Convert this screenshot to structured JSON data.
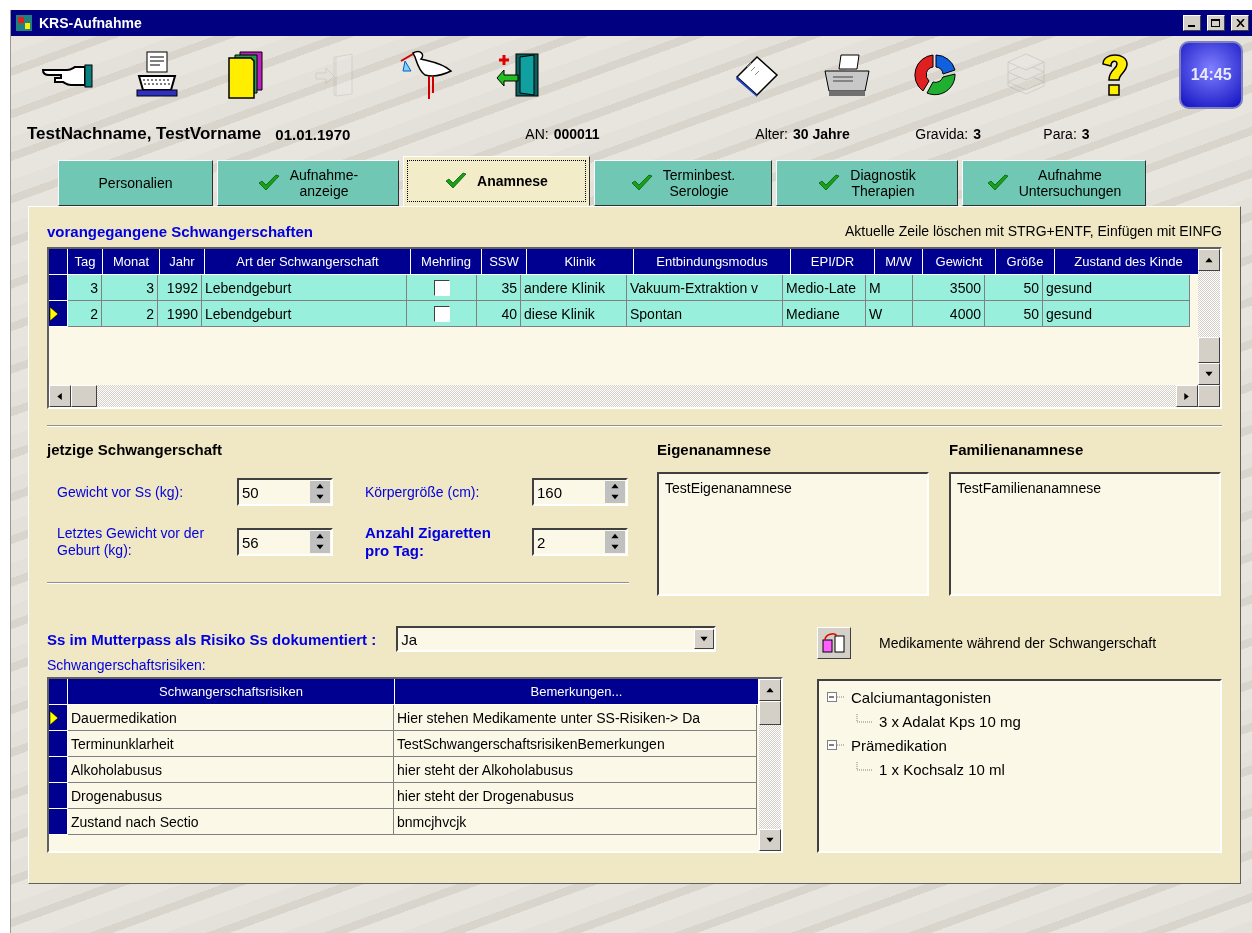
{
  "window": {
    "title": "KRS-Aufnahme"
  },
  "toolbar": [
    {
      "kind": "hand",
      "disabled": false
    },
    {
      "kind": "typewriter",
      "disabled": false
    },
    {
      "kind": "folders",
      "disabled": false
    },
    {
      "kind": "door-in",
      "disabled": true
    },
    {
      "kind": "stork",
      "disabled": false
    },
    {
      "kind": "exit-door",
      "disabled": false
    },
    {
      "kind": "gap"
    },
    {
      "kind": "notepad",
      "disabled": false
    },
    {
      "kind": "fax",
      "disabled": false
    },
    {
      "kind": "recycle",
      "disabled": false
    },
    {
      "kind": "books",
      "disabled": true
    },
    {
      "kind": "help",
      "disabled": false
    }
  ],
  "clock": "14:45",
  "patient": {
    "name": "TestNachname, TestVorname",
    "birthdate": "01.01.1970",
    "an_label": "AN:",
    "an": "000011",
    "age_label": "Alter:",
    "age": "30 Jahre",
    "gravida_label": "Gravida:",
    "gravida": "3",
    "para_label": "Para:",
    "para": "3"
  },
  "tabs": [
    {
      "lines": [
        "Personalien"
      ],
      "checked": false,
      "selected": false
    },
    {
      "lines": [
        "Aufnahme-",
        "anzeige"
      ],
      "checked": true,
      "selected": false
    },
    {
      "lines": [
        "Anamnese"
      ],
      "checked": true,
      "selected": true
    },
    {
      "lines": [
        "Terminbest.",
        "Serologie"
      ],
      "checked": true,
      "selected": false
    },
    {
      "lines": [
        "Diagnostik",
        "Therapien"
      ],
      "checked": true,
      "selected": false
    },
    {
      "lines": [
        "Aufnahme",
        "Untersuchungen"
      ],
      "checked": true,
      "selected": false
    }
  ],
  "previous_pregnancies": {
    "title": "vorangegangene Schwangerschaften",
    "hint": "Aktuelle Zeile löschen mit STRG+ENTF, Einfügen mit EINFG",
    "columns": [
      {
        "label": "Tag",
        "kind": "number"
      },
      {
        "label": "Monat",
        "kind": "number"
      },
      {
        "label": "Jahr",
        "kind": "number"
      },
      {
        "label": "Art der Schwangerschaft",
        "kind": "text"
      },
      {
        "label": "Mehrling",
        "kind": "checkbox"
      },
      {
        "label": "SSW",
        "kind": "number"
      },
      {
        "label": "Klinik",
        "kind": "text"
      },
      {
        "label": "Entbindungsmodus",
        "kind": "text"
      },
      {
        "label": "EPI/DR",
        "kind": "text"
      },
      {
        "label": "M/W",
        "kind": "text"
      },
      {
        "label": "Gewicht",
        "kind": "number"
      },
      {
        "label": "Größe",
        "kind": "number"
      },
      {
        "label": "Zustand des Kinde",
        "kind": "text"
      }
    ],
    "rows": [
      {
        "selected": false,
        "cells": [
          "3",
          "3",
          "1992",
          "Lebendgeburt",
          false,
          "35",
          "andere Klinik",
          "Vakuum-Extraktion v",
          "Medio-Late",
          "M",
          "3500",
          "50",
          "gesund"
        ]
      },
      {
        "selected": true,
        "cells": [
          "2",
          "2",
          "1990",
          "Lebendgeburt",
          false,
          "40",
          "diese Klinik",
          "Spontan",
          "Mediane",
          "W",
          "4000",
          "50",
          "gesund"
        ]
      }
    ]
  },
  "current_pregnancy": {
    "title": "jetzige Schwangerschaft",
    "fields": [
      {
        "label": "Gewicht vor Ss (kg):",
        "value": "50",
        "bold": false
      },
      {
        "label": "Körpergröße (cm):",
        "value": "160",
        "bold": false
      },
      {
        "label": "Letztes Gewicht vor der Geburt (kg):",
        "value": "56",
        "bold": false
      },
      {
        "label": "Anzahl Zigaretten pro Tag:",
        "value": "2",
        "bold": true
      }
    ]
  },
  "own_history": {
    "title": "Eigenanamnese",
    "value": "TestEigenanamnese"
  },
  "family_history": {
    "title": "Familienanamnese",
    "value": "TestFamilienanamnese"
  },
  "risk_documented": {
    "label": "Ss im Mutterpass als Risiko Ss dokumentiert :",
    "value": "Ja"
  },
  "risks": {
    "label": "Schwangerschaftsrisiken:",
    "columns": [
      "Schwangerschaftsrisiken",
      "Bemerkungen..."
    ],
    "rows": [
      {
        "selected": true,
        "cells": [
          "Dauermedikation",
          "Hier stehen Medikamente unter SS-Risiken-> Da"
        ]
      },
      {
        "selected": false,
        "cells": [
          "Terminunklarheit",
          "TestSchwangerschaftsrisikenBemerkungen"
        ]
      },
      {
        "selected": false,
        "cells": [
          "Alkoholabusus",
          "hier steht der Alkoholabusus"
        ]
      },
      {
        "selected": false,
        "cells": [
          "Drogenabusus",
          "hier steht der Drogenabusus"
        ]
      },
      {
        "selected": false,
        "cells": [
          "Zustand nach Sectio",
          "bnmcjhvcjk"
        ]
      }
    ]
  },
  "medications": {
    "label": "Medikamente während der Schwangerschaft",
    "tree": [
      {
        "label": "Calciumantagonisten",
        "expanded": true,
        "children": [
          {
            "label": "3 x Adalat Kps 10 mg"
          }
        ]
      },
      {
        "label": "Prämedikation",
        "expanded": true,
        "children": [
          {
            "label": "1 x Kochsalz 10 ml"
          }
        ]
      }
    ]
  }
}
